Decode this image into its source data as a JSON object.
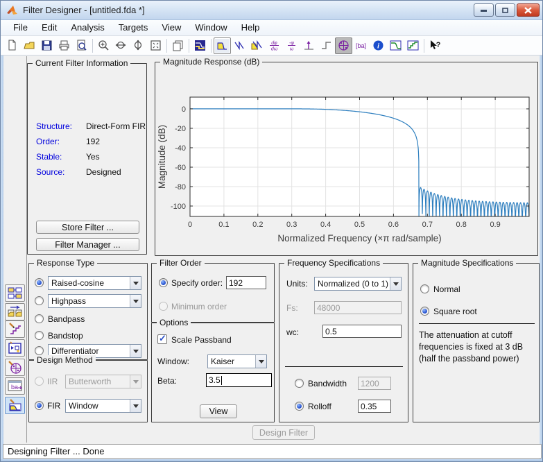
{
  "titlebar": {
    "title": "Filter Designer -  [untitled.fda *]"
  },
  "menu": {
    "items": [
      "File",
      "Edit",
      "Analysis",
      "Targets",
      "View",
      "Window",
      "Help"
    ]
  },
  "toolbar": {
    "icons": [
      "new",
      "open",
      "save",
      "print",
      "print-preview",
      "zoom-in",
      "zoom-x",
      "zoom-y",
      "full-view",
      "print-to-figure",
      "filter-specifications",
      "magnitude-response",
      "phase-response",
      "magnitude-and-phase",
      "group-delay",
      "phase-delay",
      "impulse-response",
      "step-response",
      "pole-zero-plot",
      "filter-coefficients",
      "filter-information",
      "magnitude-overlay",
      "stairstep-response",
      "context-help"
    ],
    "selected_icon": "magnitude-response",
    "pressed_icon": "pole-zero-plot"
  },
  "sidebar": {
    "icons": [
      "create-multirate-filter",
      "transform-filter",
      "set-quantization-parameters",
      "realize-model",
      "pole-zero-editor",
      "import-filter",
      "design-filter"
    ],
    "selected_icon": "design-filter"
  },
  "current_filter_info": {
    "legend": "Current Filter Information",
    "rows": [
      {
        "label": "Structure:",
        "value": "Direct-Form FIR"
      },
      {
        "label": "Order:",
        "value": "192"
      },
      {
        "label": "Stable:",
        "value": "Yes"
      },
      {
        "label": "Source:",
        "value": "Designed"
      }
    ],
    "store_filter_button": "Store Filter ...",
    "filter_manager_button": "Filter Manager ..."
  },
  "chart_data": {
    "type": "line",
    "title": "Magnitude Response (dB)",
    "xlabel": "Normalized Frequency (×π rad/sample)",
    "ylabel": "Magnitude (dB)",
    "xlim": [
      0,
      1
    ],
    "ylim": [
      -110.7,
      12.1
    ],
    "xticks": [
      0,
      0.1,
      0.2,
      0.3,
      0.4,
      0.5,
      0.6,
      0.7,
      0.8,
      0.9
    ],
    "xtick_labels": [
      "0",
      "0.1",
      "0.2",
      "0.3",
      "0.4",
      "0.5",
      "0.6",
      "0.7",
      "0.8",
      "0.9"
    ],
    "yticks": [
      0,
      -20,
      -40,
      -60,
      -80,
      -100
    ],
    "grid": true,
    "line_color": "#2e7fbf",
    "series": [
      {
        "name": "Magnitude (dB)",
        "curve_params": {
          "passband_edge": 0.325,
          "cutoff": 0.5,
          "cutoff_atten_db": -3,
          "stopband_edge": 0.675,
          "rolloff": 0.35,
          "stopband_peak_start_db": -80,
          "stopband_floor_db": -97,
          "stopband_decay": 0.085,
          "ripple_lobes": 32
        },
        "keypoints": [
          [
            0,
            0
          ],
          [
            0.325,
            0
          ],
          [
            0.4,
            -0.5
          ],
          [
            0.45,
            -1.45
          ],
          [
            0.5,
            -3
          ],
          [
            0.55,
            -5.5
          ],
          [
            0.6,
            -9.6
          ],
          [
            0.65,
            -19
          ],
          [
            0.67,
            -33
          ],
          [
            0.675,
            -80
          ],
          [
            0.7,
            -82
          ],
          [
            0.75,
            -88
          ],
          [
            0.8,
            -92
          ],
          [
            0.9,
            -95
          ],
          [
            1,
            -97
          ]
        ]
      }
    ]
  },
  "response_type": {
    "legend": "Response Type",
    "options": [
      {
        "label": "Raised-cosine",
        "selected": true
      },
      {
        "label": "Highpass"
      },
      {
        "label": "Bandpass"
      },
      {
        "label": "Bandstop"
      },
      {
        "label": "Differentiator"
      }
    ]
  },
  "design_method": {
    "legend": "Design Method",
    "iir_label": "IIR",
    "iir_value": "Butterworth",
    "fir_label": "FIR",
    "fir_value": "Window"
  },
  "filter_order": {
    "legend": "Filter Order",
    "specify_label": "Specify order:",
    "specify_value": "192",
    "minimum_label": "Minimum order"
  },
  "options_panel": {
    "legend": "Options",
    "scale_passband_label": "Scale Passband",
    "window_label": "Window:",
    "window_value": "Kaiser",
    "beta_label": "Beta:",
    "beta_value": "3.5",
    "view_button": "View"
  },
  "frequency_specs": {
    "legend": "Frequency Specifications",
    "units_label": "Units:",
    "units_value": "Normalized (0 to 1)",
    "fs_label": "Fs:",
    "fs_value": "48000",
    "wc_label": "wc:",
    "wc_value": "0.5",
    "bandwidth_label": "Bandwidth",
    "bandwidth_value": "1200",
    "rolloff_label": "Rolloff",
    "rolloff_value": "0.35"
  },
  "magnitude_specs": {
    "legend": "Magnitude Specifications",
    "normal_label": "Normal",
    "square_root_label": "Square root",
    "note_lines": [
      "The attenuation at cutoff",
      "frequencies is fixed at 3 dB",
      "(half the passband power)"
    ]
  },
  "design_filter_button": "Design Filter",
  "statusbar": {
    "text": "Designing Filter ... Done"
  },
  "colors": {
    "info_label_blue": "#0000dd",
    "curve_blue": "#2e7fbf",
    "close_button_red": "#c03a20",
    "sidebar_selected_bg": "#cde2f7",
    "panel_bg": "#f0f0f0"
  }
}
